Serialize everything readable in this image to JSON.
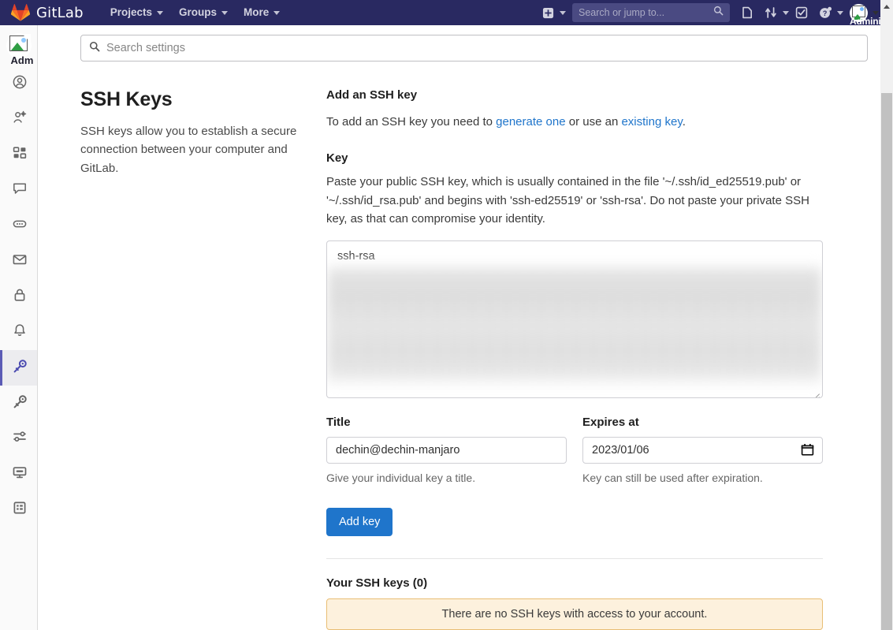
{
  "navbar": {
    "brand": "GitLab",
    "logo_icon": "gitlab-logo-icon",
    "items": [
      {
        "label": "Projects",
        "icon": "chevron-down-icon"
      },
      {
        "label": "Groups",
        "icon": "chevron-down-icon"
      },
      {
        "label": "More",
        "icon": "chevron-down-icon"
      }
    ],
    "create_new_icon": "plus-square-icon",
    "create_new_caret": "chevron-down-icon",
    "search": {
      "placeholder": "Search or jump to...",
      "value": "",
      "icon": "search-icon"
    },
    "issues_icon": "issues-icon",
    "merge_requests_icon": "merge-request-icon",
    "merge_requests_caret": "chevron-down-icon",
    "todos_icon": "todo-check-icon",
    "help_icon": "help-question-icon",
    "help_caret": "chevron-down-icon",
    "user": {
      "name": "Administra",
      "avatar_icon": "broken-image-avatar-icon",
      "caret": "chevron-down-icon"
    }
  },
  "sidebar": {
    "avatar_label": "Adm",
    "avatar_icon": "broken-image-avatar-icon",
    "items": [
      {
        "name": "profile",
        "icon": "user-circle-icon",
        "active": false
      },
      {
        "name": "account",
        "icon": "account-gear-icon",
        "active": false
      },
      {
        "name": "applications",
        "icon": "applications-grid-icon",
        "active": false
      },
      {
        "name": "chat",
        "icon": "chat-bubble-icon",
        "active": false
      },
      {
        "name": "access-tokens",
        "icon": "token-pill-icon",
        "active": false
      },
      {
        "name": "emails",
        "icon": "envelope-icon",
        "active": false
      },
      {
        "name": "password",
        "icon": "lock-icon",
        "active": false
      },
      {
        "name": "notifications",
        "icon": "bell-icon",
        "active": false
      },
      {
        "name": "ssh-keys",
        "icon": "ssh-key-icon",
        "active": true
      },
      {
        "name": "gpg-keys",
        "icon": "gpg-key-icon",
        "active": false
      },
      {
        "name": "preferences",
        "icon": "sliders-icon",
        "active": false
      },
      {
        "name": "active-sessions",
        "icon": "monitor-icon",
        "active": false
      },
      {
        "name": "authentication-log",
        "icon": "log-list-icon",
        "active": false
      }
    ]
  },
  "settings_search": {
    "placeholder": "Search settings",
    "value": "",
    "icon": "search-icon"
  },
  "left_column": {
    "title": "SSH Keys",
    "description": "SSH keys allow you to establish a secure connection between your computer and GitLab."
  },
  "form": {
    "heading": "Add an SSH key",
    "intro_before": "To add an SSH key you need to ",
    "intro_link1": "generate one",
    "intro_middle": " or use an ",
    "intro_link2": "existing key",
    "intro_after": ".",
    "key_label": "Key",
    "key_help": "Paste your public SSH key, which is usually contained in the file '~/.ssh/id_ed25519.pub' or '~/.ssh/id_rsa.pub' and begins with 'ssh-ed25519' or 'ssh-rsa'. Do not paste your private SSH key, as that can compromise your identity.",
    "key_value": "ssh-rsa",
    "key_redacted": true,
    "title_label": "Title",
    "title_value": "dechin@dechin-manjaro",
    "title_hint": "Give your individual key a title.",
    "expires_label": "Expires at",
    "expires_value": "2023/01/06",
    "expires_icon": "calendar-icon",
    "expires_hint": "Key can still be used after expiration.",
    "submit_label": "Add key"
  },
  "keys_list": {
    "heading": "Your SSH keys (0)",
    "empty_message": "There are no SSH keys with access to your account."
  },
  "colors": {
    "navbar_bg": "#292961",
    "primary_button": "#1f75cb",
    "link": "#1f75cb",
    "alert_bg": "#fdf1dd",
    "alert_border": "#e9be74",
    "active_sidebar": "#5b5bb5"
  }
}
